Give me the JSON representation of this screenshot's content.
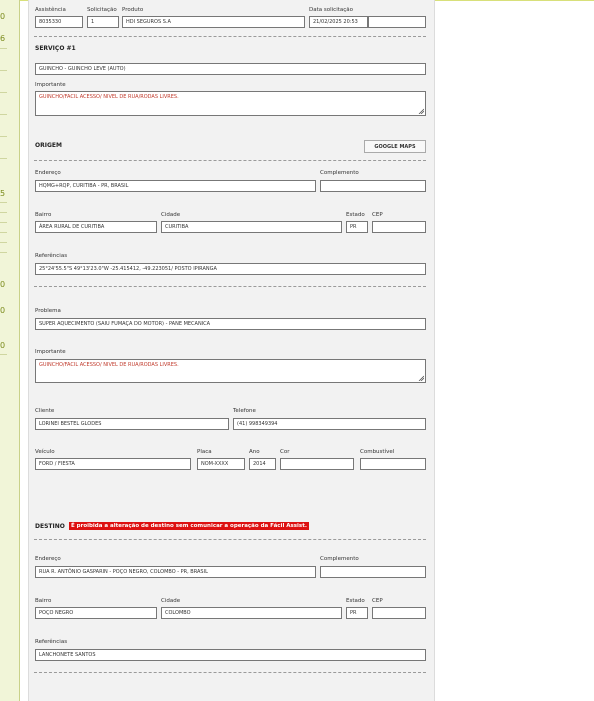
{
  "sidebar": {
    "numbers": [
      "0",
      "6",
      "5",
      "0",
      "0",
      "0"
    ]
  },
  "header": {
    "assistencia_label": "Assistência",
    "assistencia_value": "8035330",
    "solicitacao_label": "Solicitação",
    "solicitacao_value": "1",
    "produto_label": "Produto",
    "produto_value": "HDI SEGUROS S.A",
    "data_label": "Data solicitação",
    "data_value": "21/02/2025 20:53"
  },
  "servico": {
    "title": "SERVIÇO #1",
    "tipo_value": "GUINCHO - GUINCHO LEVE (AUTO)",
    "importante_label": "Importante",
    "importante_value": "GUINCHO/FACIL ACESSO/ NIVEL DE RUA/RODAS LIVRES."
  },
  "origem": {
    "title": "ORIGEM",
    "maps_button": "GOOGLE MAPS",
    "endereco_label": "Endereço",
    "endereco_value": "HQMG+RQP, CURITIBA - PR, BRASIL",
    "complemento_label": "Complemento",
    "complemento_value": "",
    "bairro_label": "Bairro",
    "bairro_value": "ÁREA RURAL DE CURITIBA",
    "cidade_label": "Cidade",
    "cidade_value": "CURITIBA",
    "estado_label": "Estado",
    "estado_value": "PR",
    "cep_label": "CEP",
    "cep_value": "",
    "referencias_label": "Referências",
    "referencias_value": "25°24'55.5\"S 49°13'23.0\"W -25.415412, -49.223051/ POSTO IPIRANGA"
  },
  "problema": {
    "label": "Problema",
    "value": "SUPER AQUECIMENTO (SAIU FUMAÇA DO MOTOR) - PANE MECANICA",
    "importante_label": "Importante",
    "importante_value": "GUINCHO/FACIL ACESSO/ NIVEL DE RUA/RODAS LIVRES."
  },
  "cliente": {
    "cliente_label": "Cliente",
    "cliente_value": "LORINEI BESTEL GLODES",
    "telefone_label": "Telefone",
    "telefone_value": "(41) 998349394"
  },
  "veiculo": {
    "veiculo_label": "Veículo",
    "veiculo_value": "FORD / FIESTA",
    "placa_label": "Placa",
    "placa_value": "NOM-XXXX",
    "ano_label": "Ano",
    "ano_value": "2014",
    "cor_label": "Cor",
    "cor_value": "",
    "combustivel_label": "Combustível",
    "combustivel_value": ""
  },
  "destino": {
    "title": "DESTINO",
    "warning": "É proibida a alteração de destino sem comunicar a operação da Fácil Assist.",
    "endereco_label": "Endereço",
    "endereco_value": "RUA R. ANTÔNIO GASPARIN - POÇO NEGRO, COLOMBO - PR, BRASIL",
    "complemento_label": "Complemento",
    "complemento_value": "",
    "bairro_label": "Bairro",
    "bairro_value": "POÇO NEGRO",
    "cidade_label": "Cidade",
    "cidade_value": "COLOMBO",
    "estado_label": "Estado",
    "estado_value": "PR",
    "cep_label": "CEP",
    "cep_value": "",
    "referencias_label": "Referências",
    "referencias_value": "LANCHONETE SANTOS"
  }
}
